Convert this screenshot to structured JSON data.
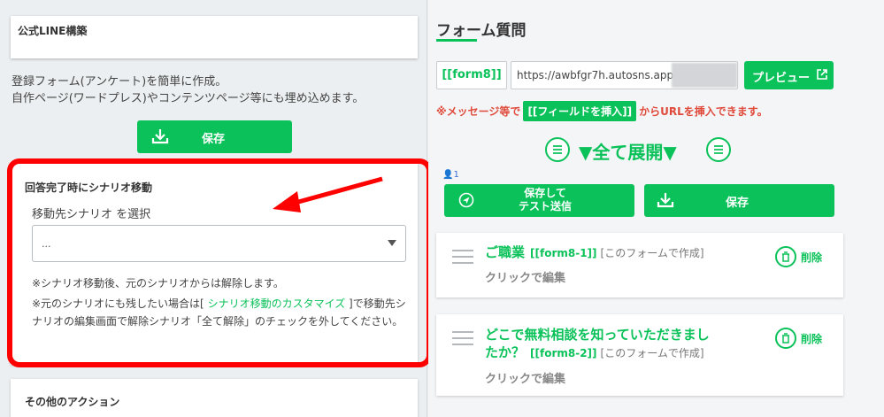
{
  "left": {
    "top_card_title": "公式LINE構築",
    "description_line1": "登録フォーム(アンケート)を簡単に作成。",
    "description_line2": "自作ページ(ワードプレス)やコンテンツページ等にも埋め込めます。",
    "save_label": "保存",
    "scenario": {
      "title": "回答完了時にシナリオ移動",
      "select_label": "移動先シナリオ を選択",
      "select_value": "...",
      "note1": "※シナリオ移動後、元のシナリオからは解除します。",
      "note2_prefix": "※元のシナリオにも残したい場合は[ ",
      "note2_link": "シナリオ移動のカスタマイズ",
      "note2_suffix": " ]で移動先シナリオの編集画面で解除シナリオ「全て解除」のチェックを外してください。"
    },
    "other_actions_title": "その他のアクション"
  },
  "right": {
    "title": "フォーム質問",
    "form_tag": "[[form8]]",
    "url": "https://awbfgr7h.autosns.app/",
    "preview_label": "プレビュー",
    "insert_prefix": "※メッセージ等で",
    "insert_chip": "[[フィールドを挿入]]",
    "insert_suffix": "からURLを挿入できます。",
    "expand_all": "▼全て展開▼",
    "user_count": "1",
    "send_test_line1": "保存して",
    "send_test_line2": "テスト送信",
    "save_label": "保存",
    "questions": [
      {
        "title": "ご職業",
        "tag": "[[form8-1]]",
        "made": "[このフォームで作成]",
        "click": "クリックで編集",
        "delete": "削除"
      },
      {
        "title_line1": "どこで無料相談を知っていただきまし",
        "title_line2": "たか？",
        "tag": "[[form8-2]]",
        "made": "[このフォームで作成]",
        "click": "クリックで編集",
        "delete": "削除"
      }
    ]
  },
  "colors": {
    "accent_green": "#0bc25a",
    "highlight_red": "#ff0000",
    "warning_red": "#e04a3b"
  }
}
